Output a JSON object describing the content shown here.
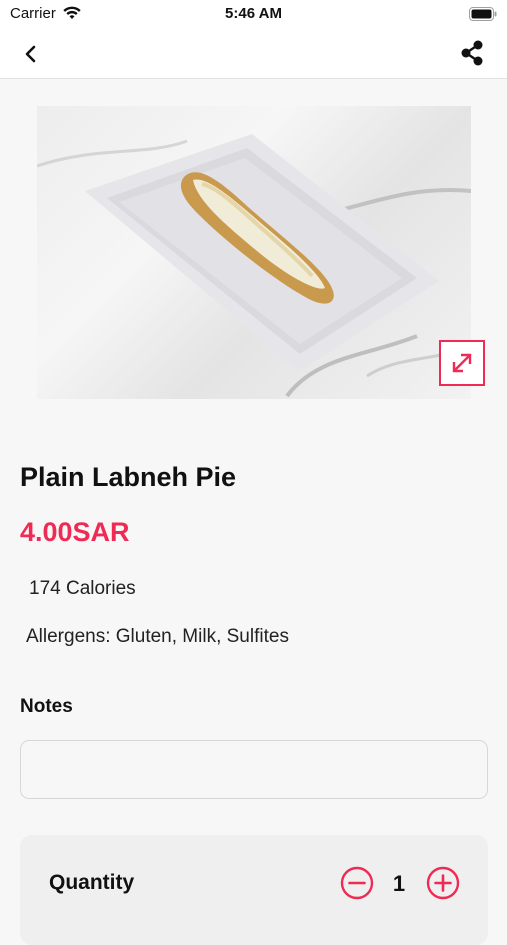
{
  "status_bar": {
    "carrier": "Carrier",
    "time": "5:46 AM"
  },
  "nav": {
    "back_icon": "chevron-left-icon",
    "share_icon": "share-icon"
  },
  "product": {
    "name": "Plain Labneh Pie",
    "price": "4.00SAR",
    "calories": "174 Calories",
    "allergens": "Allergens: Gluten, Milk, Sulfites",
    "image_icon": "expand-icon"
  },
  "notes": {
    "label": "Notes",
    "placeholder": ""
  },
  "quantity": {
    "label": "Quantity",
    "value": "1"
  },
  "colors": {
    "accent": "#ef2b55",
    "background": "#f7f7f7",
    "card": "#efefef"
  }
}
